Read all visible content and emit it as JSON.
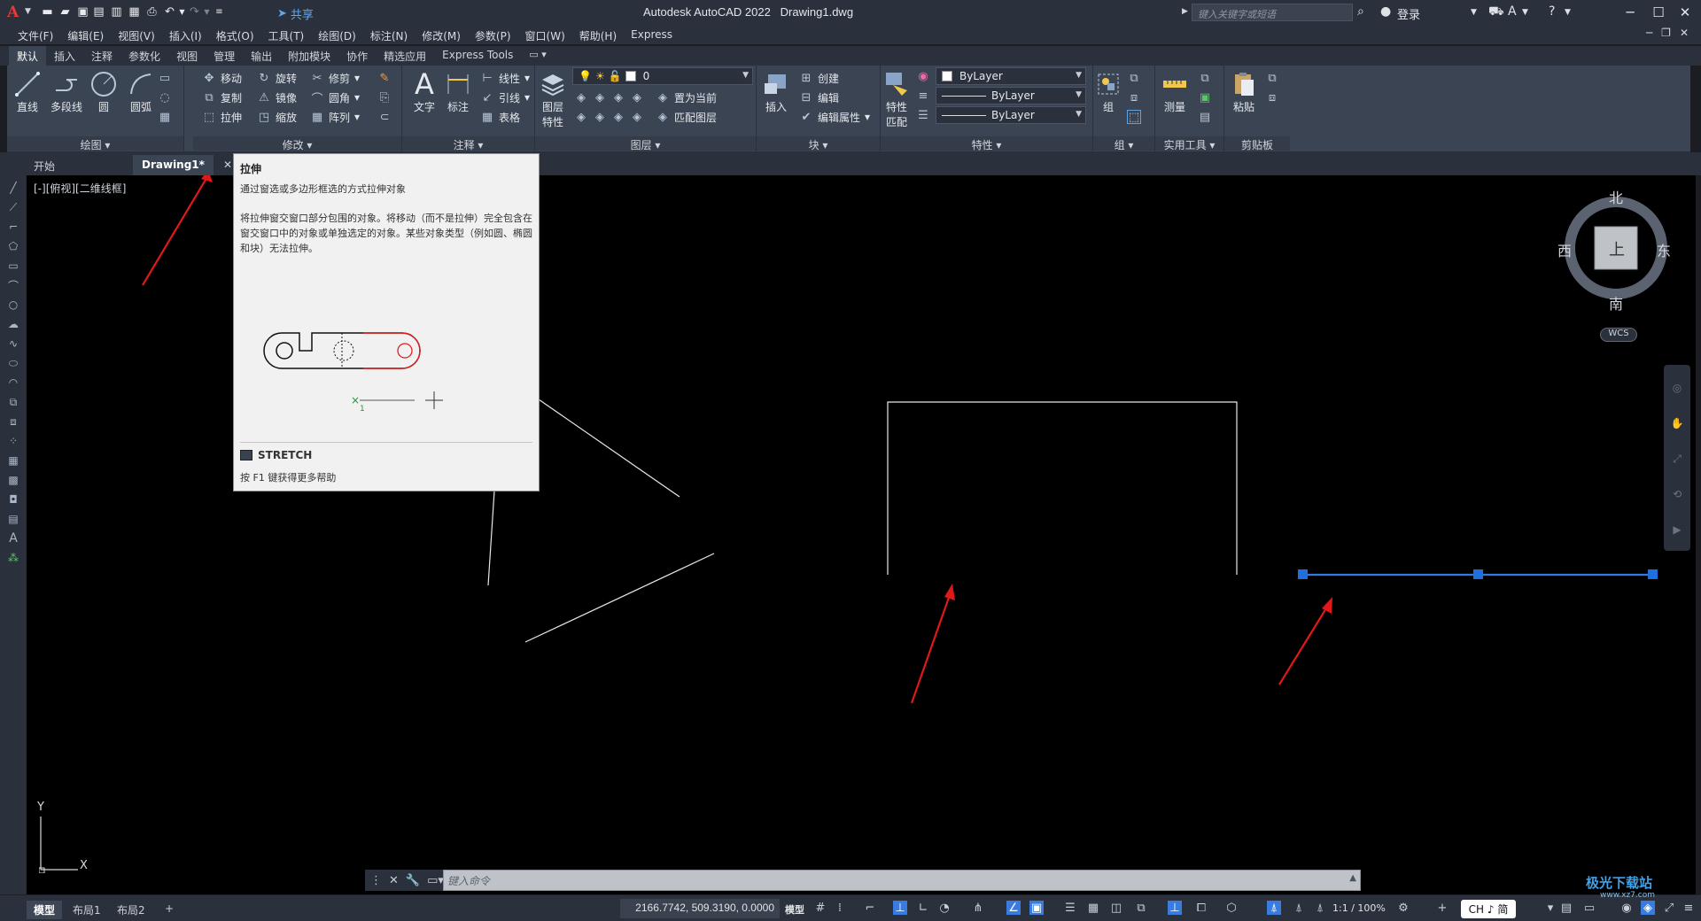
{
  "app": {
    "title": "Autodesk AutoCAD 2022",
    "document": "Drawing1.dwg",
    "share_label": "共享",
    "search_placeholder": "键入关键字或短语",
    "login_label": "登录",
    "logo": "A"
  },
  "menu": [
    "文件(F)",
    "编辑(E)",
    "视图(V)",
    "插入(I)",
    "格式(O)",
    "工具(T)",
    "绘图(D)",
    "标注(N)",
    "修改(M)",
    "参数(P)",
    "窗口(W)",
    "帮助(H)",
    "Express"
  ],
  "ribbon_tabs": [
    "默认",
    "插入",
    "注释",
    "参数化",
    "视图",
    "管理",
    "输出",
    "附加模块",
    "协作",
    "精选应用",
    "Express Tools"
  ],
  "ribbon": {
    "draw": {
      "title": "绘图",
      "line": "直线",
      "polyline": "多段线",
      "circle": "圆",
      "arc": "圆弧"
    },
    "modify": {
      "title": "修改",
      "move": "移动",
      "rotate": "旋转",
      "trim": "修剪",
      "copy": "复制",
      "mirror": "镜像",
      "fillet": "圆角",
      "stretch": "拉伸",
      "scale": "缩放",
      "array": "阵列"
    },
    "annotation": {
      "title": "注释",
      "text": "文字",
      "dimension": "标注",
      "linear": "线性",
      "leader": "引线",
      "table": "表格"
    },
    "layers": {
      "title": "图层",
      "layer_props": "图层特性",
      "layer_props_1": "图层",
      "layer_props_2": "特性",
      "current_layer": "0",
      "set_current": "置为当前",
      "match_layer": "匹配图层"
    },
    "block": {
      "title": "块",
      "insert": "插入",
      "create": "创建",
      "edit": "编辑",
      "edit_attr": "编辑属性"
    },
    "properties": {
      "title": "特性",
      "match": "特性匹配",
      "match_1": "特性",
      "match_2": "匹配",
      "color": "ByLayer",
      "linetype": "ByLayer",
      "lineweight": "ByLayer"
    },
    "groups": {
      "title": "组",
      "group": "组"
    },
    "utilities": {
      "title": "实用工具",
      "measure": "测量"
    },
    "clipboard": {
      "title": "剪贴板",
      "paste": "粘贴"
    }
  },
  "file_tabs": [
    "开始",
    "Drawing1*"
  ],
  "viewport_label": "[-][俯视][二维线框]",
  "viewcube": {
    "north": "北",
    "south": "南",
    "east": "东",
    "west": "西",
    "face": "上",
    "wcs": "WCS"
  },
  "tooltip": {
    "title": "拉伸",
    "desc": "通过窗选或多边形框选的方式拉伸对象",
    "body": "将拉伸窗交窗口部分包围的对象。将移动（而不是拉伸）完全包含在窗交窗口中的对象或单独选定的对象。某些对象类型（例如圆、椭圆和块）无法拉伸。",
    "command": "STRETCH",
    "help": "按 F1 键获得更多帮助"
  },
  "ucs": {
    "x": "X",
    "y": "Y"
  },
  "command_line": {
    "placeholder": "键入命令"
  },
  "status": {
    "tabs": [
      "模型",
      "布局1",
      "布局2"
    ],
    "add_tab": "+",
    "coords": "2166.7742, 509.3190, 0.0000",
    "model": "模型",
    "scale": "1:1 / 100%",
    "ime": "CH ♪ 简"
  },
  "watermark": {
    "text": "极光下载站",
    "sub": "www.xz7.com"
  },
  "colors": {
    "accent": "#3a7be0",
    "arrow": "#e01818",
    "grip": "#1f6fe0"
  }
}
